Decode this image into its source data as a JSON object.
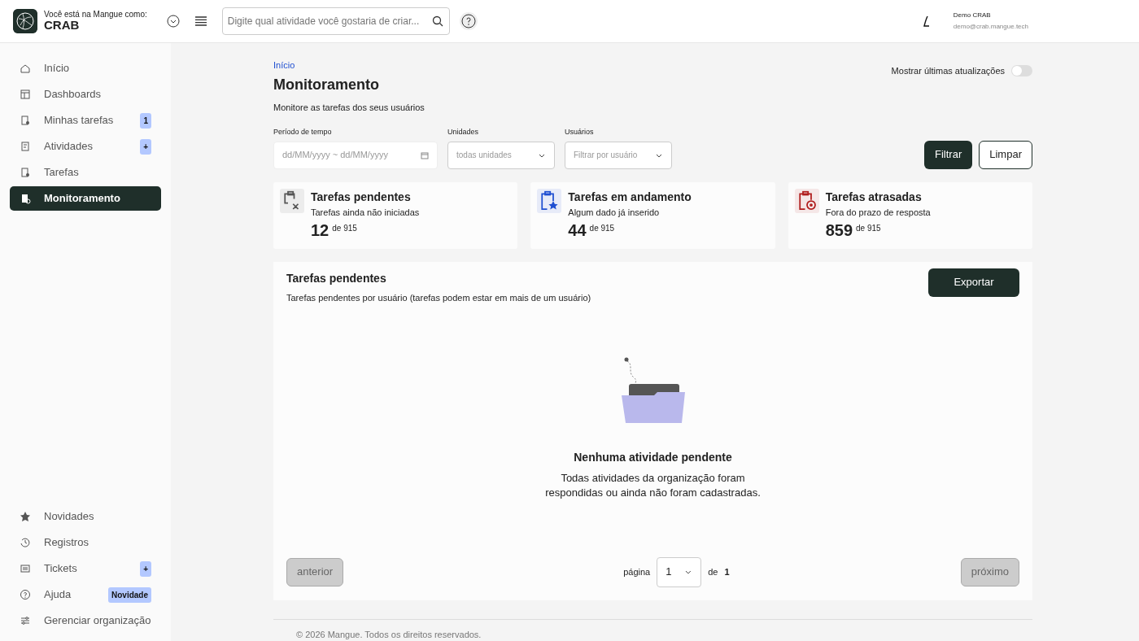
{
  "header": {
    "org_prefix": "Você está na Mangue como:",
    "org_name": "CRAB",
    "search": {
      "placeholder": "Digite qual atividade você gostaria de criar..."
    },
    "user": {
      "name": "Demo CRAB",
      "email": "demo@crab.mangue.tech"
    }
  },
  "sidebar": {
    "items": [
      {
        "label": "Início",
        "selected": false
      },
      {
        "label": "Dashboards",
        "selected": false
      },
      {
        "label": "Minhas tarefas",
        "badge": "1",
        "selected": false
      },
      {
        "label": "Atividades",
        "badge": "+",
        "selected": false
      },
      {
        "label": "Tarefas",
        "selected": false
      },
      {
        "label": "Monitoramento",
        "selected": true
      }
    ],
    "bottom_items": [
      {
        "label": "Novidades"
      },
      {
        "label": "Registros"
      },
      {
        "label": "Tickets",
        "badge": "+"
      },
      {
        "label": "Ajuda",
        "badge": "Novidade"
      },
      {
        "label": "Gerenciar organização"
      }
    ]
  },
  "breadcrumb": "Início",
  "title": "Monitoramento",
  "subtitle": "Monitore as tarefas dos seus usuários",
  "toggle": {
    "label": "Mostrar últimas atualizações",
    "on": false
  },
  "filters": [
    {
      "kind": "date",
      "label": "Período de tempo",
      "placeholder": "dd/MM/yyyy ~ dd/MM/yyyy"
    },
    {
      "kind": "select",
      "label": "Unidades",
      "placeholder": "todas unidades"
    },
    {
      "kind": "select",
      "label": "Usuários",
      "placeholder": "Filtrar por usuário"
    }
  ],
  "buttons": [
    {
      "label": "Filtrar",
      "kind": "primary"
    },
    {
      "label": "Limpar",
      "kind": "outline"
    }
  ],
  "stats": [
    {
      "title": "Tarefas pendentes",
      "subtitle": "Tarefas ainda não iniciadas",
      "value": "12",
      "total": "de 915",
      "color": "#555555"
    },
    {
      "title": "Tarefas em andamento",
      "subtitle": "Algum dado já inserido",
      "value": "44",
      "total": "de 915",
      "color": "#1f4fd1"
    },
    {
      "title": "Tarefas atrasadas",
      "subtitle": "Fora do prazo de resposta",
      "value": "859",
      "total": "de 915",
      "color": "#b01c1c"
    }
  ],
  "panel": {
    "title": "Tarefas pendentes",
    "subtitle": "Tarefas pendentes por usuário (tarefas podem estar em mais de um usuário)",
    "export": "Exportar",
    "empty_title": "Nenhuma atividade pendente",
    "empty_text": "Todas atividades da organização foram respondidas ou ainda não foram cadastradas.",
    "pagination": {
      "previous": {
        "label": "anterior",
        "disabled": true
      },
      "page_label": "página",
      "page": "1",
      "of": "de",
      "total": "1",
      "next": {
        "label": "próximo",
        "disabled": true
      }
    }
  },
  "footer": "© 2026 Mangue. Todos os direitos reservados."
}
